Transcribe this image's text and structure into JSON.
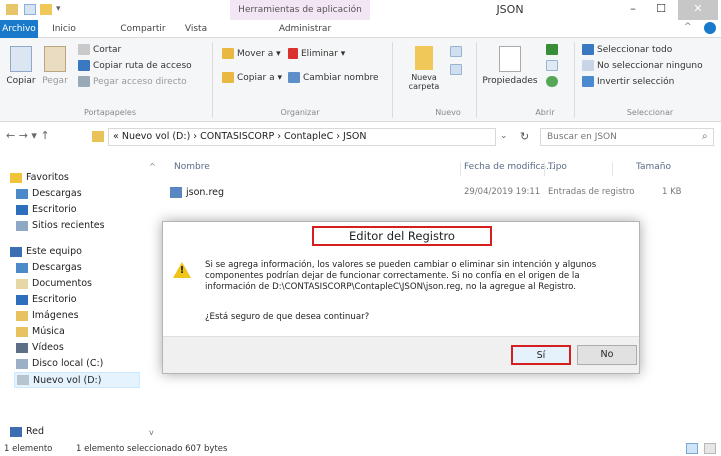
{
  "titlebar": {
    "context_tab": "Herramientas de aplicación",
    "title": "JSON",
    "minimize": "–",
    "maximize": "☐",
    "close": "✕"
  },
  "ribbon_tabs": [
    "Archivo",
    "Inicio",
    "Compartir",
    "Vista",
    "Administrar"
  ],
  "ribbon": {
    "portapapeles": {
      "label": "Portapapeles",
      "copiar": "Copiar",
      "pegar": "Pegar",
      "cortar": "Cortar",
      "copiar_ruta": "Copiar ruta de acceso",
      "pegar_acceso": "Pegar acceso directo"
    },
    "organizar": {
      "label": "Organizar",
      "mover": "Mover a ▾",
      "copiar_a": "Copiar a ▾",
      "eliminar": "Eliminar ▾",
      "cambiar_nombre": "Cambiar nombre"
    },
    "nuevo": {
      "label": "Nuevo",
      "nueva_carpeta_1": "Nueva",
      "nueva_carpeta_2": "carpeta"
    },
    "abrir": {
      "label": "Abrir",
      "propiedades": "Propiedades"
    },
    "seleccionar": {
      "label": "Seleccionar",
      "todo": "Seleccionar todo",
      "ninguno": "No seleccionar ninguno",
      "invertir": "Invertir selección"
    }
  },
  "address": {
    "path": "« Nuevo vol (D:)  ›  CONTASISCORP  ›  ContapleC  ›  JSON",
    "refresh": "↻",
    "search_placeholder": "Buscar en JSON",
    "nav": "←  →  ▾  ↑"
  },
  "navpane": {
    "items": [
      "Favoritos",
      "Descargas",
      "Escritorio",
      "Sitios recientes",
      "Este equipo",
      "Descargas",
      "Documentos",
      "Escritorio",
      "Imágenes",
      "Música",
      "Vídeos",
      "Disco local (C:)",
      "Nuevo vol (D:)",
      "Red"
    ]
  },
  "filelist": {
    "columns": [
      "Nombre",
      "Fecha de modifica...",
      "Tipo",
      "Tamaño"
    ],
    "rows": [
      {
        "name": "json.reg",
        "date": "29/04/2019 19:11",
        "type": "Entradas de registro",
        "size": "1 KB"
      }
    ]
  },
  "statusbar": {
    "count": "1 elemento",
    "selected": "1 elemento seleccionado  607 bytes"
  },
  "dialog": {
    "title": "Editor del Registro",
    "message": "Si se agrega información, los valores se pueden cambiar o eliminar sin intención y algunos componentes podrían dejar de funcionar correctamente. Si no confía en el origen de la información de D:\\CONTASISCORP\\ContapleC\\JSON\\json.reg, no la agregue al Registro.",
    "question": "¿Está seguro de que desea continuar?",
    "yes": "Sí",
    "no": "No"
  },
  "colors": {
    "accent": "#1979ca",
    "highlight": "#d51e1e",
    "warning": "#f0c419"
  }
}
